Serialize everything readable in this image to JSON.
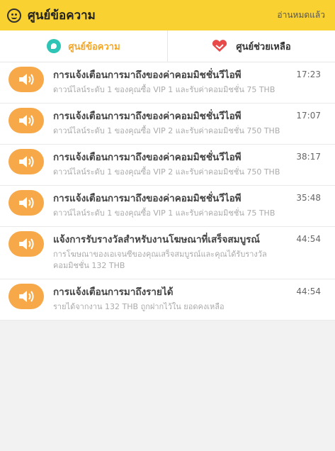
{
  "header": {
    "icon": "smiley-chat-icon",
    "title": "ศูนย์ข้อความ",
    "mark_all_read": "อ่านหมดแล้ว"
  },
  "tabs": [
    {
      "label": "ศูนย์ข้อความ",
      "icon": "chat-bubble-icon",
      "active": true
    },
    {
      "label": "ศูนย์ช่วยเหลือ",
      "icon": "heart-help-icon",
      "active": false
    }
  ],
  "colors": {
    "header_bg": "#f9d131",
    "active_tab": "#f5a623",
    "avatar": "#f7a94a",
    "bubble_icon": "#2ec4b6",
    "heart_icon": "#e84a4a"
  },
  "messages": [
    {
      "icon": "speaker-icon",
      "title": "การแจ้งเตือนการมาถึงของค่าคอมมิชชั่นวีไอพี",
      "desc": "ดาวน์ไลน์ระดับ 1 ของคุณซื้อ VIP 1 และรับค่าคอมมิชชั่น 75 THB",
      "time": "17:23"
    },
    {
      "icon": "speaker-icon",
      "title": "การแจ้งเตือนการมาถึงของค่าคอมมิชชั่นวีไอพี",
      "desc": "ดาวน์ไลน์ระดับ 1 ของคุณซื้อ VIP 2 และรับค่าคอมมิชชั่น 750 THB",
      "time": "17:07"
    },
    {
      "icon": "speaker-icon",
      "title": "การแจ้งเตือนการมาถึงของค่าคอมมิชชั่นวีไอพี",
      "desc": "ดาวน์ไลน์ระดับ 1 ของคุณซื้อ VIP 2 และรับค่าคอมมิชชั่น 750 THB",
      "time": "38:17"
    },
    {
      "icon": "speaker-icon",
      "title": "การแจ้งเตือนการมาถึงของค่าคอมมิชชั่นวีไอพี",
      "desc": "ดาวน์ไลน์ระดับ 1 ของคุณซื้อ VIP 1 และรับค่าคอมมิชชั่น 75 THB",
      "time": "35:48"
    },
    {
      "icon": "speaker-icon",
      "title": "แจ้งการรับรางวัลสำหรับงานโฆษณาที่เสร็จสมบูรณ์",
      "desc": "การโฆษณาของเอเจนซีของคุณเสร็จสมบูรณ์และคุณได้รับรางวัลคอมมิชชั่น 132 THB",
      "time": "44:54"
    },
    {
      "icon": "speaker-icon",
      "title": "การแจ้งเตือนการมาถึงรายได้",
      "desc": "รายได้จากงาน 132 THB ถูกฝากไว้ใน ยอดคงเหลือ",
      "time": "44:54"
    }
  ]
}
